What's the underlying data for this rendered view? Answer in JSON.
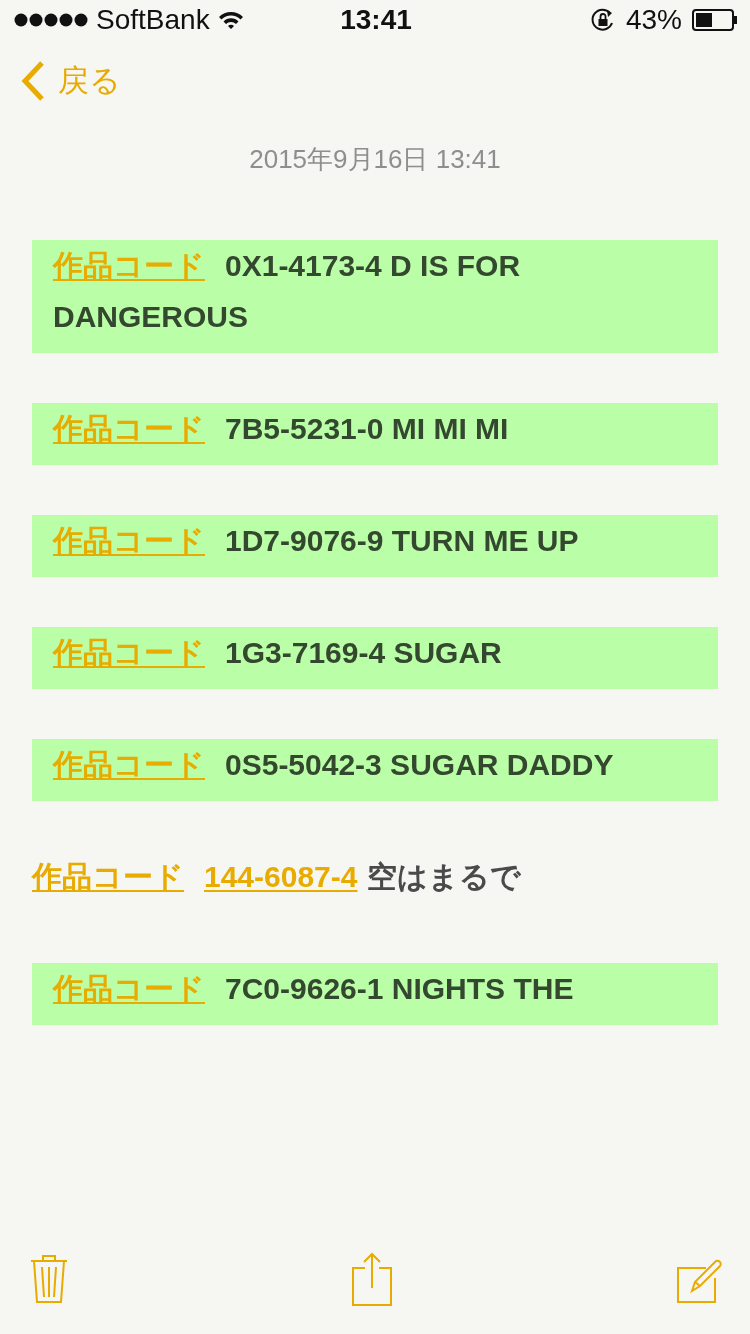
{
  "status_bar": {
    "carrier": "SoftBank",
    "time": "13:41",
    "battery": "43%"
  },
  "nav": {
    "back": "戻る"
  },
  "note": {
    "date": "2015年9月16日 13:41",
    "lines": [
      {
        "link": "作品コード",
        "code": "0X1-4173-4",
        "title": "D IS FOR",
        "continuation": "DANGEROUS",
        "code_linked": false,
        "highlighted": true
      },
      {
        "link": "作品コード",
        "code": "7B5-5231-0",
        "title": "MI MI MI",
        "code_linked": false,
        "highlighted": true
      },
      {
        "link": "作品コード",
        "code": "1D7-9076-9",
        "title": "TURN ME UP",
        "code_linked": false,
        "highlighted": true
      },
      {
        "link": "作品コード",
        "code": "1G3-7169-4",
        "title": "SUGAR",
        "code_linked": false,
        "highlighted": true
      },
      {
        "link": "作品コード",
        "code": "0S5-5042-3",
        "title": "SUGAR DADDY",
        "code_linked": false,
        "highlighted": true
      },
      {
        "link": "作品コード",
        "code": "144-6087-4",
        "title": "空はまるで",
        "code_linked": true,
        "highlighted": false
      },
      {
        "link": "作品コード",
        "code": "7C0-9626-1",
        "title": "NIGHTS THE",
        "code_linked": false,
        "highlighted": true
      }
    ]
  }
}
